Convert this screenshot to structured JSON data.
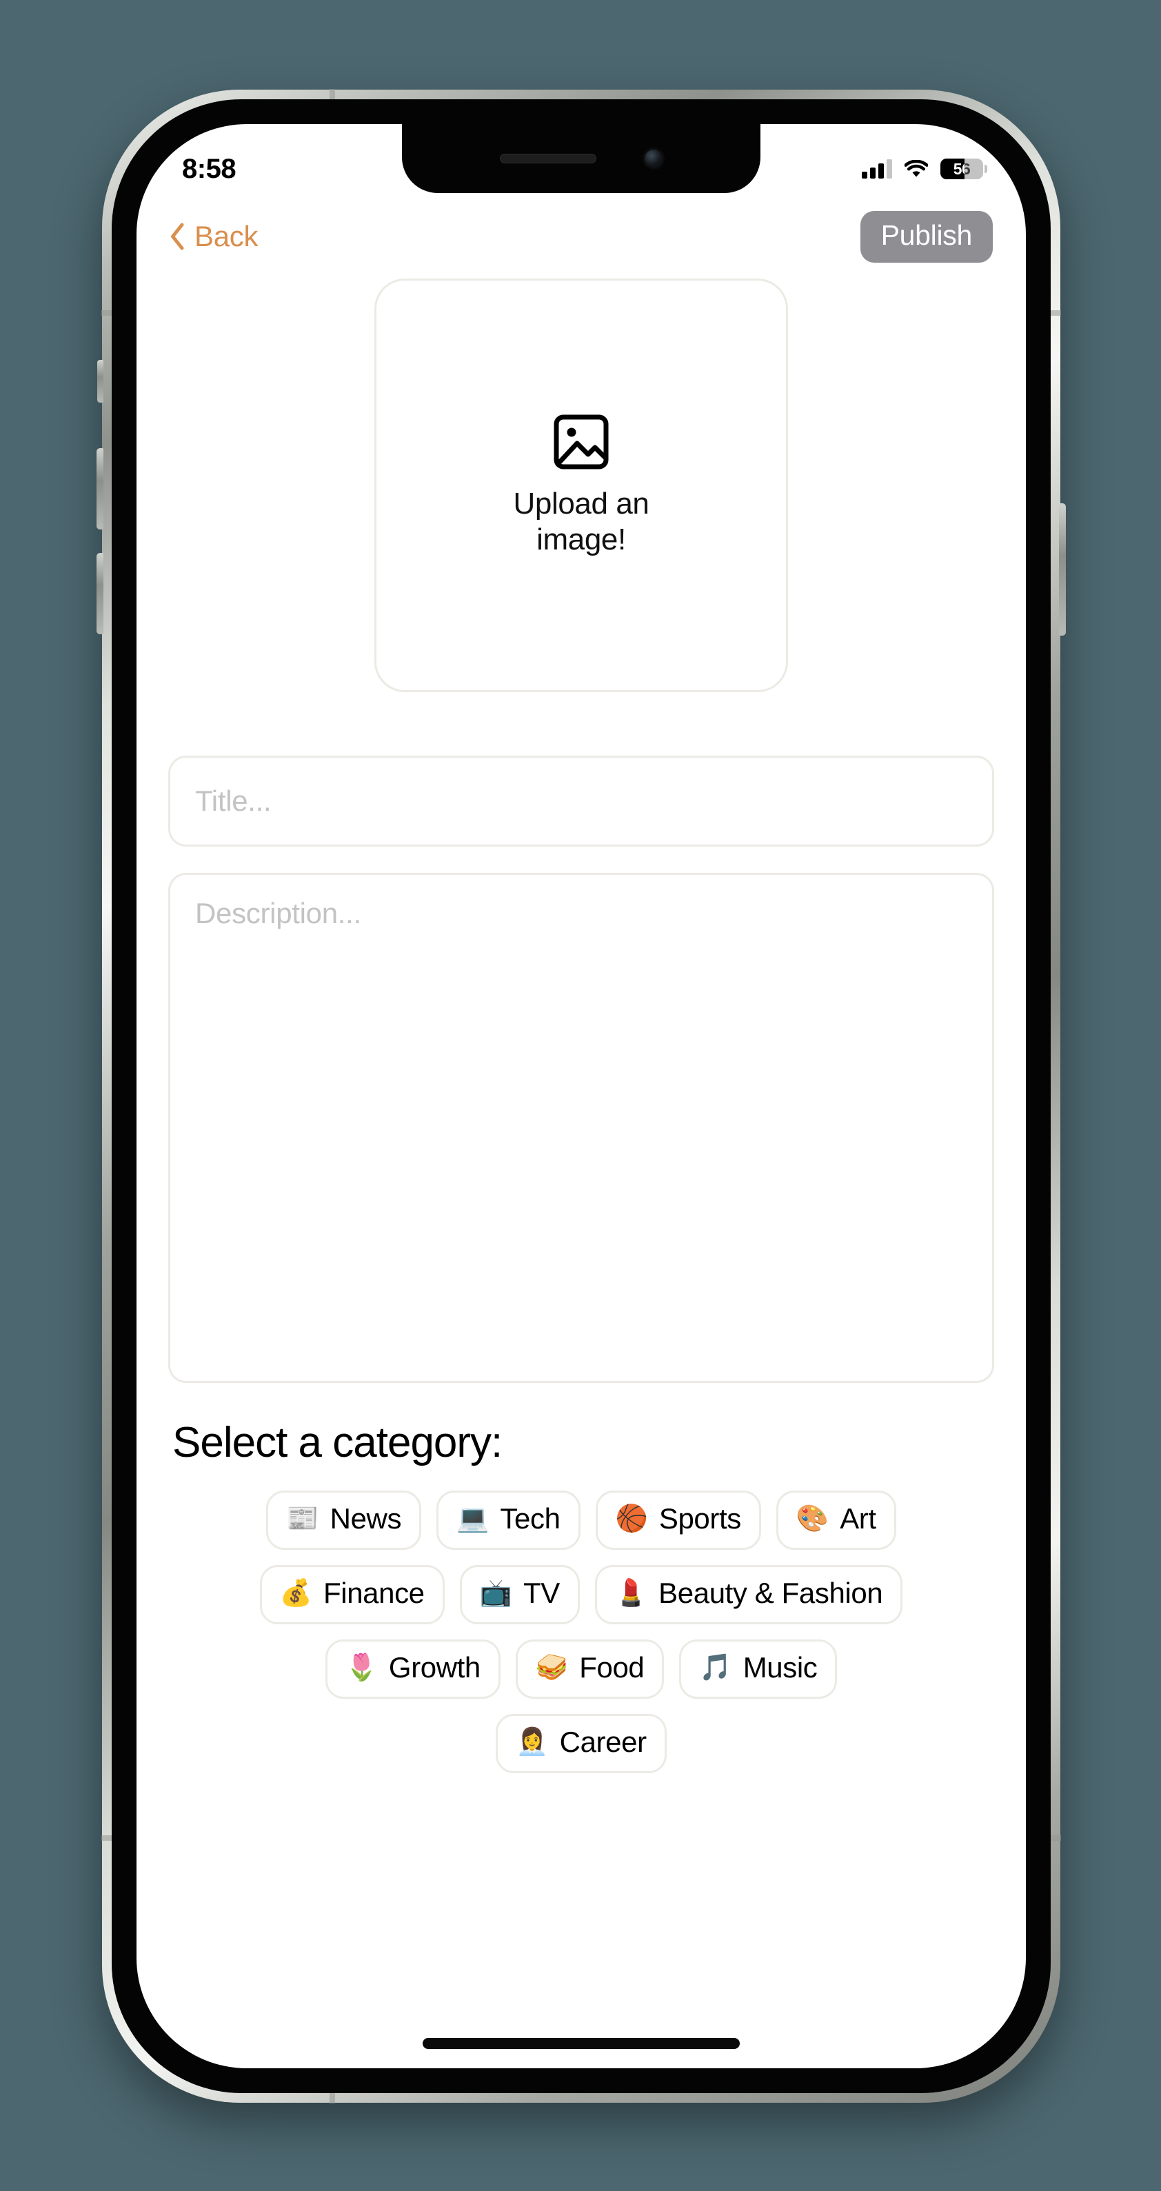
{
  "theme": {
    "background": "#4c6770",
    "accent_orange": "#d98f4e",
    "publish_bg": "#8e8e93",
    "border_gray": "#eceae4",
    "placeholder_gray": "#c3c3c3"
  },
  "status_bar": {
    "time": "8:58",
    "cellular_icon": "signal-bars-icon",
    "cellular_bars_filled": 3,
    "cellular_bars_total": 4,
    "wifi_icon": "wifi-icon",
    "battery_icon": "battery-icon",
    "battery_percent": "56",
    "battery_level": 56
  },
  "nav_bar": {
    "back_icon": "chevron-left-icon",
    "back_label": "Back",
    "publish_label": "Publish"
  },
  "upload": {
    "icon": "image-placeholder-icon",
    "label": "Upload an image!"
  },
  "form": {
    "title_placeholder": "Title...",
    "title_value": "",
    "description_placeholder": "Description...",
    "description_value": ""
  },
  "categories": {
    "heading": "Select a category:",
    "rows": [
      [
        {
          "emoji": "📰",
          "icon": "newspaper-icon",
          "label": "News"
        },
        {
          "emoji": "💻",
          "icon": "laptop-icon",
          "label": "Tech"
        },
        {
          "emoji": "🏀",
          "icon": "basketball-icon",
          "label": "Sports"
        },
        {
          "emoji": "🎨",
          "icon": "artist-palette-icon",
          "label": "Art"
        }
      ],
      [
        {
          "emoji": "💰",
          "icon": "money-bag-icon",
          "label": "Finance"
        },
        {
          "emoji": "📺",
          "icon": "television-icon",
          "label": "TV"
        },
        {
          "emoji": "💄",
          "icon": "lipstick-icon",
          "label": "Beauty & Fashion"
        }
      ],
      [
        {
          "emoji": "🌷",
          "icon": "tulip-icon",
          "label": "Growth"
        },
        {
          "emoji": "🥪",
          "icon": "sandwich-icon",
          "label": "Food"
        },
        {
          "emoji": "🎵",
          "icon": "musical-note-icon",
          "label": "Music"
        }
      ],
      [
        {
          "emoji": "👩‍💼",
          "icon": "office-worker-icon",
          "label": "Career"
        }
      ]
    ]
  }
}
